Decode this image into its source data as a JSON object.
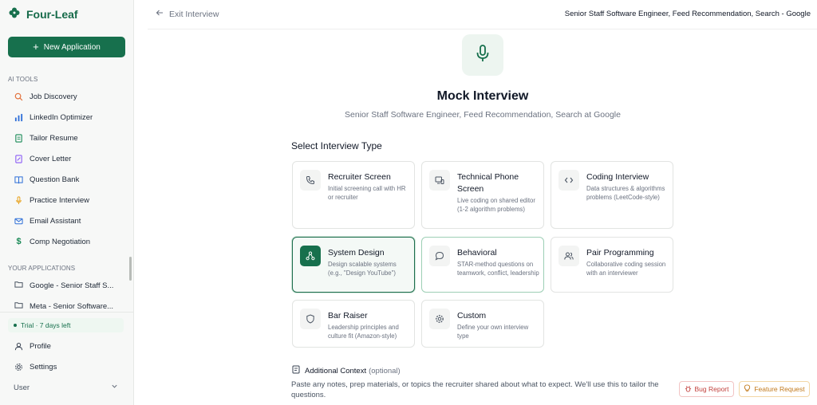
{
  "brand": {
    "name": "Four-Leaf",
    "color": "#166b4a"
  },
  "sidebar": {
    "new_application": "New Application",
    "ai_tools_label": "AI TOOLS",
    "ai_tools": [
      {
        "label": "Job Discovery",
        "icon": "search-icon"
      },
      {
        "label": "LinkedIn Optimizer",
        "icon": "chart-icon"
      },
      {
        "label": "Tailor Resume",
        "icon": "document-icon"
      },
      {
        "label": "Cover Letter",
        "icon": "file-edit-icon"
      },
      {
        "label": "Question Bank",
        "icon": "book-icon"
      },
      {
        "label": "Practice Interview",
        "icon": "microphone-icon"
      },
      {
        "label": "Email Assistant",
        "icon": "mail-icon"
      },
      {
        "label": "Comp Negotiation",
        "icon": "dollar-icon"
      }
    ],
    "applications_label": "YOUR APPLICATIONS",
    "applications": [
      {
        "label": "Google - Senior Staff S...",
        "icon": "folder-icon"
      },
      {
        "label": "Meta - Senior Software...",
        "icon": "folder-icon"
      }
    ],
    "trial": "Trial · 7 days left",
    "profile": "Profile",
    "settings": "Settings",
    "user": "User"
  },
  "header": {
    "exit": "Exit Interview",
    "title": "Senior Staff Software Engineer, Feed Recommendation, Search - Google"
  },
  "hero": {
    "title": "Mock Interview",
    "subtitle": "Senior Staff Software Engineer, Feed Recommendation, Search at Google"
  },
  "select_label": "Select Interview Type",
  "interview_types": [
    {
      "title": "Recruiter Screen",
      "desc": "Initial screening call with HR or recruiter",
      "icon": "phone-icon"
    },
    {
      "title": "Technical Phone Screen",
      "desc": "Live coding on shared editor (1-2 algorithm problems)",
      "icon": "screen-share-icon"
    },
    {
      "title": "Coding Interview",
      "desc": "Data structures & algorithms problems (LeetCode-style)",
      "icon": "code-icon"
    },
    {
      "title": "System Design",
      "desc": "Design scalable systems (e.g., \"Design YouTube\")",
      "icon": "network-icon",
      "selected": true
    },
    {
      "title": "Behavioral",
      "desc": "STAR-method questions on teamwork, conflict, leadership",
      "icon": "chat-bubble-icon"
    },
    {
      "title": "Pair Programming",
      "desc": "Collaborative coding session with an interviewer",
      "icon": "users-icon"
    },
    {
      "title": "Bar Raiser",
      "desc": "Leadership principles and culture fit (Amazon-style)",
      "icon": "shield-icon"
    },
    {
      "title": "Custom",
      "desc": "Define your own interview type",
      "icon": "gear-icon"
    }
  ],
  "context": {
    "label": "Additional Context",
    "optional": "(optional)",
    "help": "Paste any notes, prep materials, or topics the recruiter shared about what to expect. We'll use this to tailor the questions."
  },
  "floating": {
    "bug_report": "Bug Report",
    "feature_request": "Feature Request"
  },
  "colors": {
    "accent": "#17704d",
    "selected_bg": "#f4f9f6",
    "bug": "#c2413d",
    "feature": "#c27a1c"
  }
}
